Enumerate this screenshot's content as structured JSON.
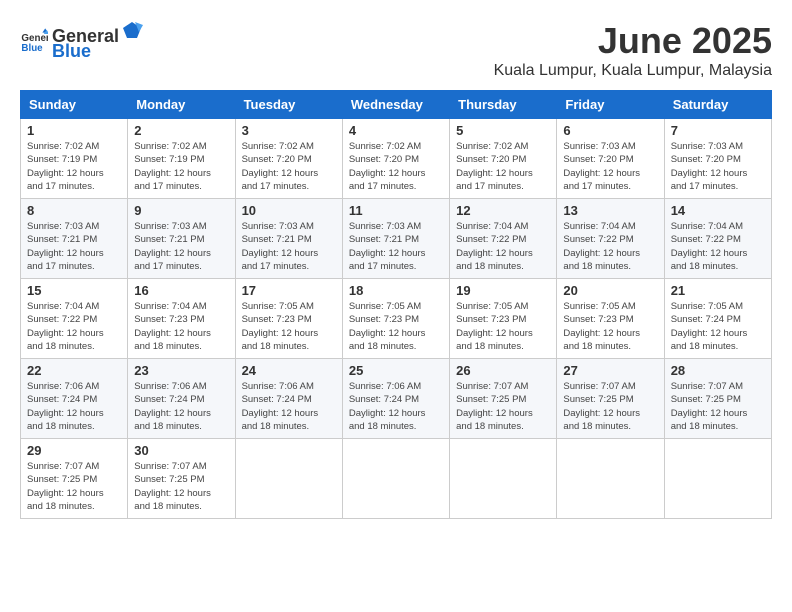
{
  "logo": {
    "text_general": "General",
    "text_blue": "Blue"
  },
  "title": "June 2025",
  "location": "Kuala Lumpur, Kuala Lumpur, Malaysia",
  "days_of_week": [
    "Sunday",
    "Monday",
    "Tuesday",
    "Wednesday",
    "Thursday",
    "Friday",
    "Saturday"
  ],
  "weeks": [
    [
      {
        "day": "1",
        "sunrise": "7:02 AM",
        "sunset": "7:19 PM",
        "daylight": "12 hours and 17 minutes."
      },
      {
        "day": "2",
        "sunrise": "7:02 AM",
        "sunset": "7:19 PM",
        "daylight": "12 hours and 17 minutes."
      },
      {
        "day": "3",
        "sunrise": "7:02 AM",
        "sunset": "7:20 PM",
        "daylight": "12 hours and 17 minutes."
      },
      {
        "day": "4",
        "sunrise": "7:02 AM",
        "sunset": "7:20 PM",
        "daylight": "12 hours and 17 minutes."
      },
      {
        "day": "5",
        "sunrise": "7:02 AM",
        "sunset": "7:20 PM",
        "daylight": "12 hours and 17 minutes."
      },
      {
        "day": "6",
        "sunrise": "7:03 AM",
        "sunset": "7:20 PM",
        "daylight": "12 hours and 17 minutes."
      },
      {
        "day": "7",
        "sunrise": "7:03 AM",
        "sunset": "7:20 PM",
        "daylight": "12 hours and 17 minutes."
      }
    ],
    [
      {
        "day": "8",
        "sunrise": "7:03 AM",
        "sunset": "7:21 PM",
        "daylight": "12 hours and 17 minutes."
      },
      {
        "day": "9",
        "sunrise": "7:03 AM",
        "sunset": "7:21 PM",
        "daylight": "12 hours and 17 minutes."
      },
      {
        "day": "10",
        "sunrise": "7:03 AM",
        "sunset": "7:21 PM",
        "daylight": "12 hours and 17 minutes."
      },
      {
        "day": "11",
        "sunrise": "7:03 AM",
        "sunset": "7:21 PM",
        "daylight": "12 hours and 17 minutes."
      },
      {
        "day": "12",
        "sunrise": "7:04 AM",
        "sunset": "7:22 PM",
        "daylight": "12 hours and 18 minutes."
      },
      {
        "day": "13",
        "sunrise": "7:04 AM",
        "sunset": "7:22 PM",
        "daylight": "12 hours and 18 minutes."
      },
      {
        "day": "14",
        "sunrise": "7:04 AM",
        "sunset": "7:22 PM",
        "daylight": "12 hours and 18 minutes."
      }
    ],
    [
      {
        "day": "15",
        "sunrise": "7:04 AM",
        "sunset": "7:22 PM",
        "daylight": "12 hours and 18 minutes."
      },
      {
        "day": "16",
        "sunrise": "7:04 AM",
        "sunset": "7:23 PM",
        "daylight": "12 hours and 18 minutes."
      },
      {
        "day": "17",
        "sunrise": "7:05 AM",
        "sunset": "7:23 PM",
        "daylight": "12 hours and 18 minutes."
      },
      {
        "day": "18",
        "sunrise": "7:05 AM",
        "sunset": "7:23 PM",
        "daylight": "12 hours and 18 minutes."
      },
      {
        "day": "19",
        "sunrise": "7:05 AM",
        "sunset": "7:23 PM",
        "daylight": "12 hours and 18 minutes."
      },
      {
        "day": "20",
        "sunrise": "7:05 AM",
        "sunset": "7:23 PM",
        "daylight": "12 hours and 18 minutes."
      },
      {
        "day": "21",
        "sunrise": "7:05 AM",
        "sunset": "7:24 PM",
        "daylight": "12 hours and 18 minutes."
      }
    ],
    [
      {
        "day": "22",
        "sunrise": "7:06 AM",
        "sunset": "7:24 PM",
        "daylight": "12 hours and 18 minutes."
      },
      {
        "day": "23",
        "sunrise": "7:06 AM",
        "sunset": "7:24 PM",
        "daylight": "12 hours and 18 minutes."
      },
      {
        "day": "24",
        "sunrise": "7:06 AM",
        "sunset": "7:24 PM",
        "daylight": "12 hours and 18 minutes."
      },
      {
        "day": "25",
        "sunrise": "7:06 AM",
        "sunset": "7:24 PM",
        "daylight": "12 hours and 18 minutes."
      },
      {
        "day": "26",
        "sunrise": "7:07 AM",
        "sunset": "7:25 PM",
        "daylight": "12 hours and 18 minutes."
      },
      {
        "day": "27",
        "sunrise": "7:07 AM",
        "sunset": "7:25 PM",
        "daylight": "12 hours and 18 minutes."
      },
      {
        "day": "28",
        "sunrise": "7:07 AM",
        "sunset": "7:25 PM",
        "daylight": "12 hours and 18 minutes."
      }
    ],
    [
      {
        "day": "29",
        "sunrise": "7:07 AM",
        "sunset": "7:25 PM",
        "daylight": "12 hours and 18 minutes."
      },
      {
        "day": "30",
        "sunrise": "7:07 AM",
        "sunset": "7:25 PM",
        "daylight": "12 hours and 18 minutes."
      },
      null,
      null,
      null,
      null,
      null
    ]
  ],
  "labels": {
    "sunrise": "Sunrise:",
    "sunset": "Sunset:",
    "daylight": "Daylight:"
  }
}
